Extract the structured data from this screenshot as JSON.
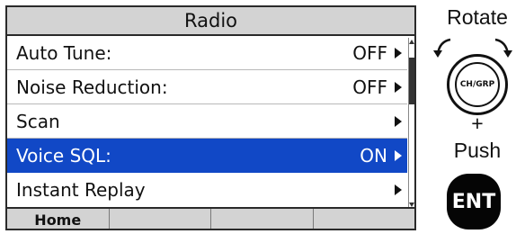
{
  "screen": {
    "title": "Radio",
    "menu_items": [
      {
        "label": "Auto Tune:",
        "value": "OFF",
        "selected": false
      },
      {
        "label": "Noise Reduction:",
        "value": "OFF",
        "selected": false
      },
      {
        "label": "Scan",
        "value": "",
        "selected": false
      },
      {
        "label": "Voice SQL:",
        "value": "ON",
        "selected": true
      },
      {
        "label": "Instant Replay",
        "value": "",
        "selected": false
      }
    ],
    "softkeys": [
      "Home",
      "",
      "",
      ""
    ],
    "colors": {
      "selection": "#1148c6",
      "bars": "#d3d3d3"
    }
  },
  "controls": {
    "rotate_label": "Rotate",
    "knob_label": "CH/GRP",
    "plus_label": "+",
    "push_label": "Push",
    "enter_label": "ENT"
  }
}
